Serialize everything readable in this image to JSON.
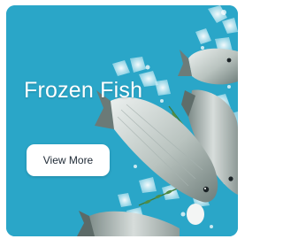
{
  "banner": {
    "title": "Frozen Fish",
    "button_label": "View More",
    "accent_color": "#2aa6c8"
  }
}
